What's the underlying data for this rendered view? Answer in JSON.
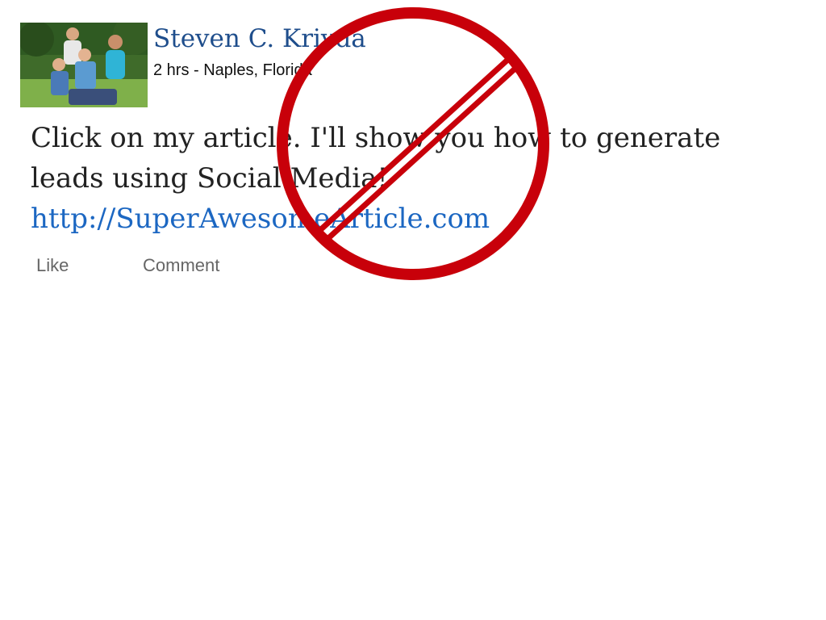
{
  "author": {
    "name": "Steven C. Krivda",
    "meta": "2 hrs - Naples, Florida"
  },
  "post": {
    "line1": "Click on my article. I'll show you how to generate",
    "line2": "leads using Social Media!",
    "link_text": "http://SuperAwesomeArticle.com"
  },
  "actions": {
    "like_label": "Like",
    "comment_label": "Comment"
  },
  "overlay": {
    "icon": "prohibition-icon",
    "color": "#c8000a"
  },
  "colors": {
    "author_name": "#1f4e8c",
    "link": "#1c67c2",
    "body_text": "#222222",
    "action_text": "#666666"
  }
}
